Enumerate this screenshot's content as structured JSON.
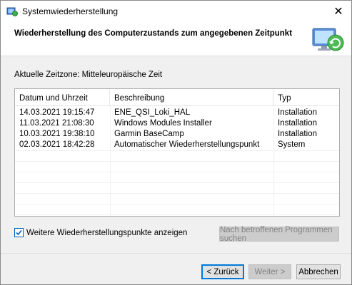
{
  "window": {
    "title": "Systemwiederherstellung",
    "close_glyph": "✕"
  },
  "header": {
    "title": "Wiederherstellung des Computerzustands zum angegebenen Zeitpunkt"
  },
  "timezone": "Aktuelle Zeitzone: Mitteleuropäische Zeit",
  "table": {
    "columns": [
      "Datum und Uhrzeit",
      "Beschreibung",
      "Typ"
    ],
    "rows": [
      {
        "date": "14.03.2021 19:15:47",
        "desc": "ENE_QSI_Loki_HAL",
        "type": "Installation"
      },
      {
        "date": "11.03.2021 21:08:30",
        "desc": "Windows Modules Installer",
        "type": "Installation"
      },
      {
        "date": "10.03.2021 19:38:10",
        "desc": "Garmin BaseCamp",
        "type": "Installation"
      },
      {
        "date": "02.03.2021 18:42:28",
        "desc": "Automatischer Wiederherstellungspunkt",
        "type": "System"
      }
    ]
  },
  "options": {
    "show_more_label": "Weitere Wiederherstellungspunkte anzeigen",
    "show_more_checked": true,
    "scan_button": "Nach betroffenen Programmen suchen"
  },
  "footer": {
    "back": "< Zurück",
    "next": "Weiter >",
    "cancel": "Abbrechen"
  },
  "colors": {
    "accent": "#0078d7",
    "checkbox": "#005fb8"
  }
}
